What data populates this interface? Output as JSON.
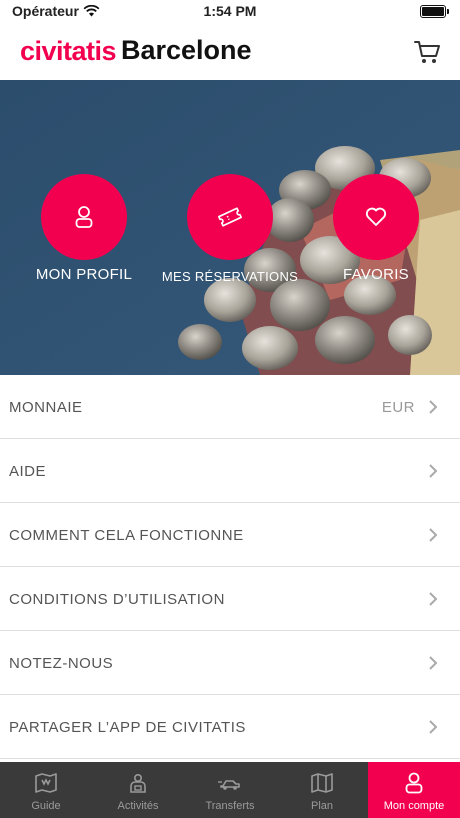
{
  "status_bar": {
    "carrier": "Opérateur",
    "time": "1:54 PM"
  },
  "header": {
    "brand": "civitatis",
    "city": "Barcelone"
  },
  "hero": {
    "buttons": [
      {
        "label": "MON PROFIL",
        "icon": "user-icon"
      },
      {
        "label": "MES RÉSERVATIONS",
        "icon": "ticket-icon"
      },
      {
        "label": "FAVORIS",
        "icon": "heart-icon"
      }
    ]
  },
  "menu": {
    "items": [
      {
        "label": "MONNAIE",
        "value": "EUR"
      },
      {
        "label": "AIDE"
      },
      {
        "label": "COMMENT CELA FONCTIONNE"
      },
      {
        "label": "CONDITIONS D’UTILISATION"
      },
      {
        "label": "NOTEZ-NOUS"
      },
      {
        "label": "PARTAGER L’APP DE CIVITATIS"
      }
    ]
  },
  "tabbar": {
    "tabs": [
      {
        "label": "Guide",
        "icon": "map-pin-icon"
      },
      {
        "label": "Activités",
        "icon": "guide-person-icon"
      },
      {
        "label": "Transferts",
        "icon": "car-icon"
      },
      {
        "label": "Plan",
        "icon": "map-icon"
      },
      {
        "label": "Mon compte",
        "icon": "user-icon",
        "active": true
      }
    ]
  },
  "colors": {
    "accent": "#f2004f",
    "hero_bg": "#2f5170",
    "tabbar_bg": "#3a3a3a"
  }
}
